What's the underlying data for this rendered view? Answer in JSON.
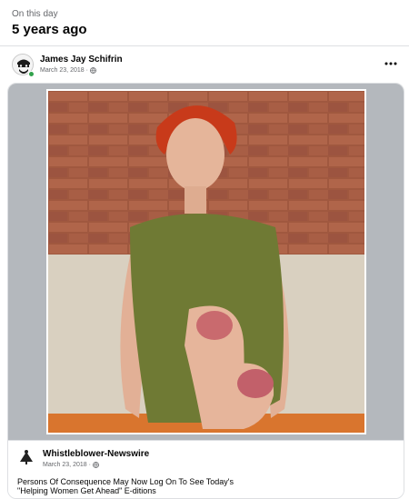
{
  "memory": {
    "label": "On this day",
    "years_ago": "5 years ago"
  },
  "post": {
    "author": "James Jay Schifrin",
    "date": "March 23, 2018 ·",
    "privacy_icon": "globe-icon",
    "more_icon": "more-options-icon"
  },
  "shared": {
    "image_description_icon": "shared-photo",
    "page_name": "Whistleblower-Newswire",
    "date": "March 23, 2018 ·",
    "caption_line1": "Persons Of Consequence May Now Log On To See Today's",
    "caption_line2": "\"Helping Women Get Ahead\" E-ditions"
  },
  "colors": {
    "secondary_text": "#65676b",
    "online": "#31a24c",
    "frame_gray": "#b4b8bd"
  }
}
